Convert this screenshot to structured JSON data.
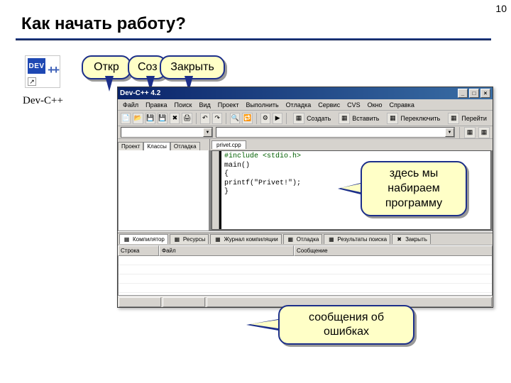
{
  "slide": {
    "number": "10",
    "title": "Как начать работу?"
  },
  "icon": {
    "badge": "DEV",
    "plus": "++",
    "caption": "Dev-C++",
    "arrow_glyph": "↗"
  },
  "callouts": {
    "open": "Откр",
    "new": "Соз",
    "close": "Закрыть",
    "code_area": "здесь мы набираем программу",
    "errors": "сообщения об ошибках"
  },
  "app": {
    "title": "Dev-C++ 4.2",
    "win_buttons": {
      "min": "_",
      "max": "□",
      "close": "×"
    },
    "menu": [
      "Файл",
      "Правка",
      "Поиск",
      "Вид",
      "Проект",
      "Выполнить",
      "Отладка",
      "Сервис",
      "CVS",
      "Окно",
      "Справка"
    ],
    "toolbar_labels": {
      "create": "Создать",
      "insert": "Вставить",
      "switch": "Переключить",
      "goto": "Перейти"
    },
    "left_tabs": [
      "Проект",
      "Классы",
      "Отладка"
    ],
    "editor_tab": "privet.cpp",
    "code_lines": [
      {
        "t": "inc",
        "s": "#include <stdio.h>"
      },
      {
        "t": "plain",
        "s": "main()"
      },
      {
        "t": "plain",
        "s": "{"
      },
      {
        "t": "call",
        "s": "printf(\"Privet!\");"
      },
      {
        "t": "plain",
        "s": "}"
      }
    ],
    "bottom_tabs": [
      "Компилятор",
      "Ресурсы",
      "Журнал компиляции",
      "Отладка",
      "Результаты поиска",
      "Закрыть"
    ],
    "grid_headers": [
      "Строка",
      "Файл",
      "Сообщение"
    ]
  }
}
